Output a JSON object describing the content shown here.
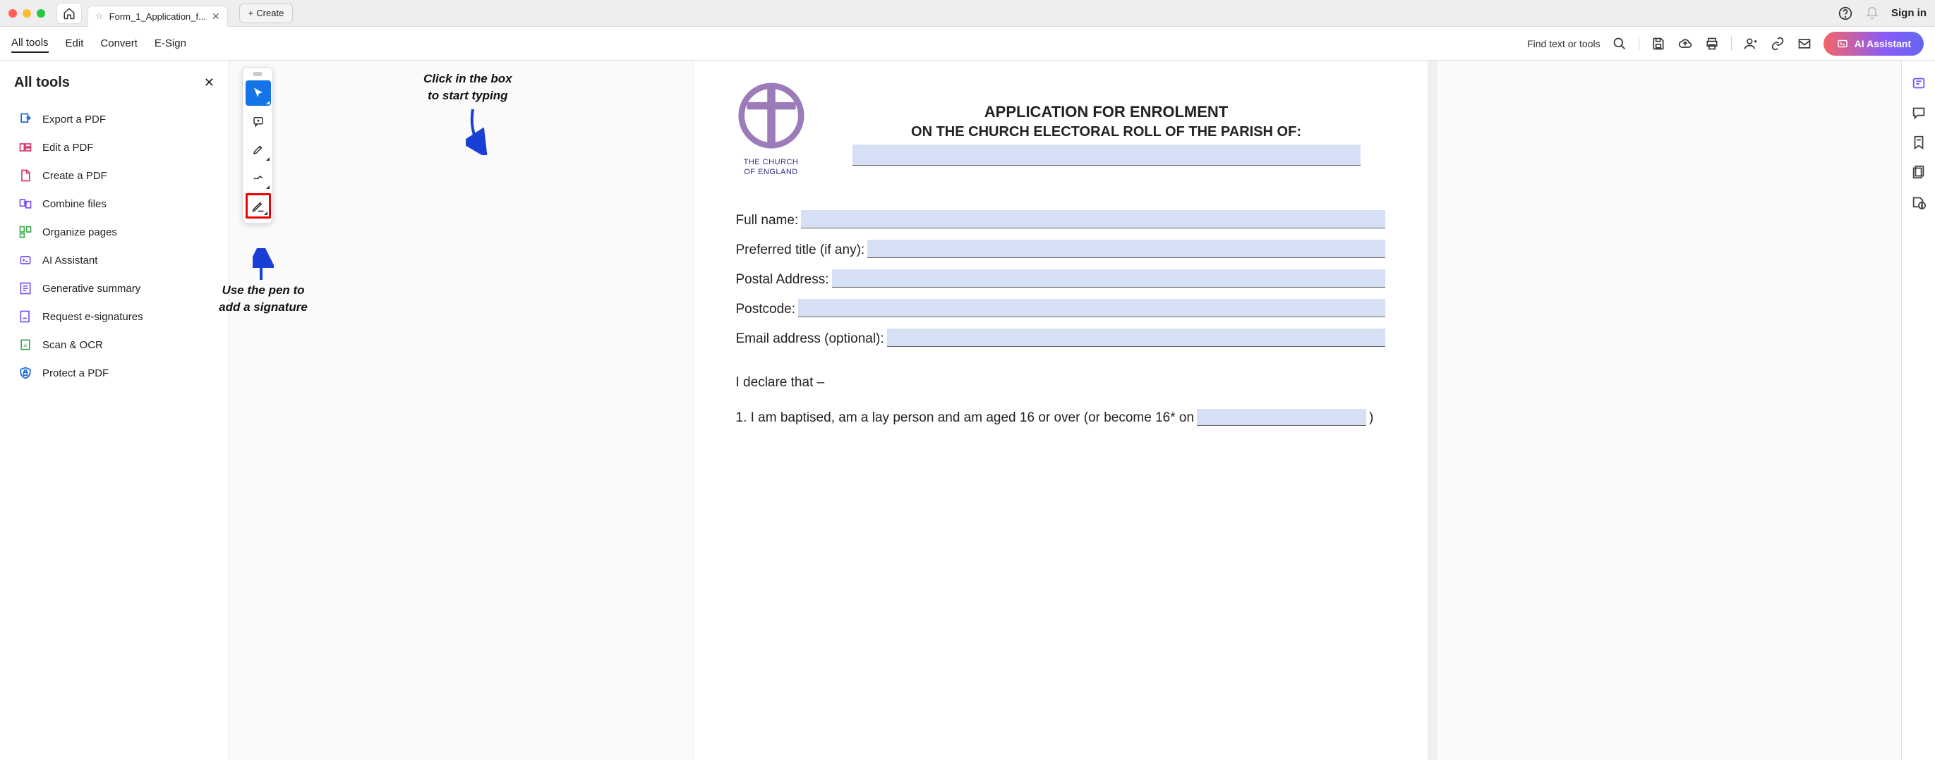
{
  "titlebar": {
    "tab_title": "Form_1_Application_f...",
    "create_label": "Create",
    "signin_label": "Sign in"
  },
  "menu": {
    "all_tools": "All tools",
    "edit": "Edit",
    "convert": "Convert",
    "esign": "E-Sign",
    "find_placeholder": "Find text or tools",
    "ai_assistant": "AI Assistant"
  },
  "sidebar": {
    "title": "All tools",
    "items": [
      {
        "label": "Export a PDF",
        "icon": "export-icon",
        "color": "#0d66d0"
      },
      {
        "label": "Edit a PDF",
        "icon": "edit-icon",
        "color": "#d7376b"
      },
      {
        "label": "Create a PDF",
        "icon": "create-icon",
        "color": "#d7376b"
      },
      {
        "label": "Combine files",
        "icon": "combine-icon",
        "color": "#7a4ff1"
      },
      {
        "label": "Organize pages",
        "icon": "organize-icon",
        "color": "#3da74e"
      },
      {
        "label": "AI Assistant",
        "icon": "ai-icon",
        "color": "#7a4ff1"
      },
      {
        "label": "Generative summary",
        "icon": "summary-icon",
        "color": "#7a4ff1"
      },
      {
        "label": "Request e-signatures",
        "icon": "sign-icon",
        "color": "#7a4ff1"
      },
      {
        "label": "Scan & OCR",
        "icon": "scan-icon",
        "color": "#3da74e"
      },
      {
        "label": "Protect a PDF",
        "icon": "protect-icon",
        "color": "#0d66d0"
      }
    ]
  },
  "annotations": {
    "top_line1": "Click in the box",
    "top_line2": "to start typing",
    "sig_line1": "Use the pen to",
    "sig_line2": "add a signature"
  },
  "document": {
    "logo_caption1": "THE CHURCH",
    "logo_caption2": "OF ENGLAND",
    "title1": "APPLICATION FOR ENROLMENT",
    "title2": "ON THE CHURCH ELECTORAL ROLL OF THE PARISH OF:",
    "labels": {
      "full_name": "Full name:",
      "pref_title": "Preferred title (if any):",
      "postal": "Postal Address:",
      "postcode": "Postcode:",
      "email": "Email address (optional):"
    },
    "declare": "I declare that –",
    "item1_a": "1. I am baptised, am a lay person and am aged 16 or over (or become 16* on",
    "item1_b": ")"
  }
}
